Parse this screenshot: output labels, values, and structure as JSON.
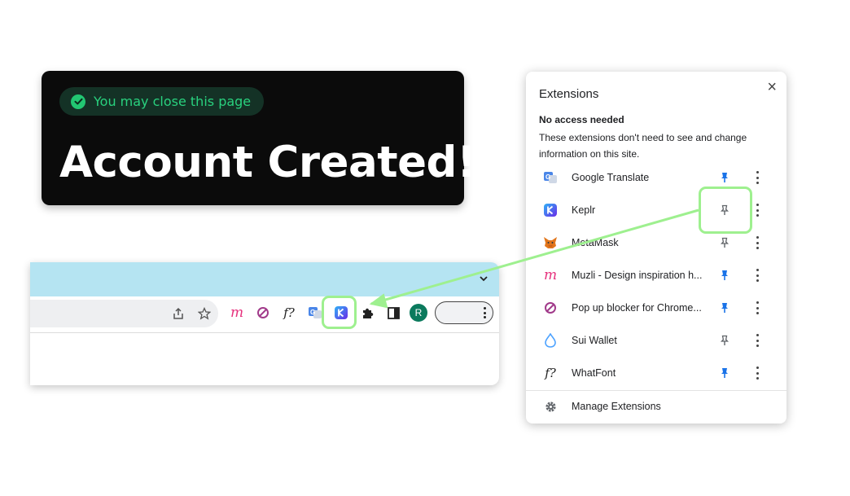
{
  "card": {
    "pill_text": "You may close this page",
    "title": "Account Created!",
    "accent": "#22c772"
  },
  "browser": {
    "tab_color": "#b5e4f2",
    "toolbar_icons": [
      "share-icon",
      "star-icon",
      "muzli-icon",
      "popup-blocker-icon",
      "whatfont-icon",
      "google-translate-icon",
      "keplr-icon",
      "extensions-puzzle-icon",
      "sidebar-icon"
    ],
    "avatar_letter": "R"
  },
  "popup": {
    "title": "Extensions",
    "close": "×",
    "section_title": "No access needed",
    "section_desc": "These extensions don't need to see and change information on this site.",
    "extensions": [
      {
        "name": "Google Translate",
        "pinned": true,
        "icon": "google-translate-icon"
      },
      {
        "name": "Keplr",
        "pinned": false,
        "icon": "keplr-icon"
      },
      {
        "name": "MetaMask",
        "pinned": false,
        "icon": "metamask-icon"
      },
      {
        "name": "Muzli - Design inspiration h...",
        "pinned": true,
        "icon": "muzli-icon"
      },
      {
        "name": "Pop up blocker for Chrome...",
        "pinned": true,
        "icon": "popup-blocker-icon"
      },
      {
        "name": "Sui Wallet",
        "pinned": false,
        "icon": "sui-wallet-icon"
      },
      {
        "name": "WhatFont",
        "pinned": true,
        "icon": "whatfont-icon"
      }
    ],
    "manage_label": "Manage Extensions"
  },
  "colors": {
    "pin_active": "#1a73e8",
    "pin_inactive": "#5f6368",
    "highlight": "#9ef08f"
  }
}
